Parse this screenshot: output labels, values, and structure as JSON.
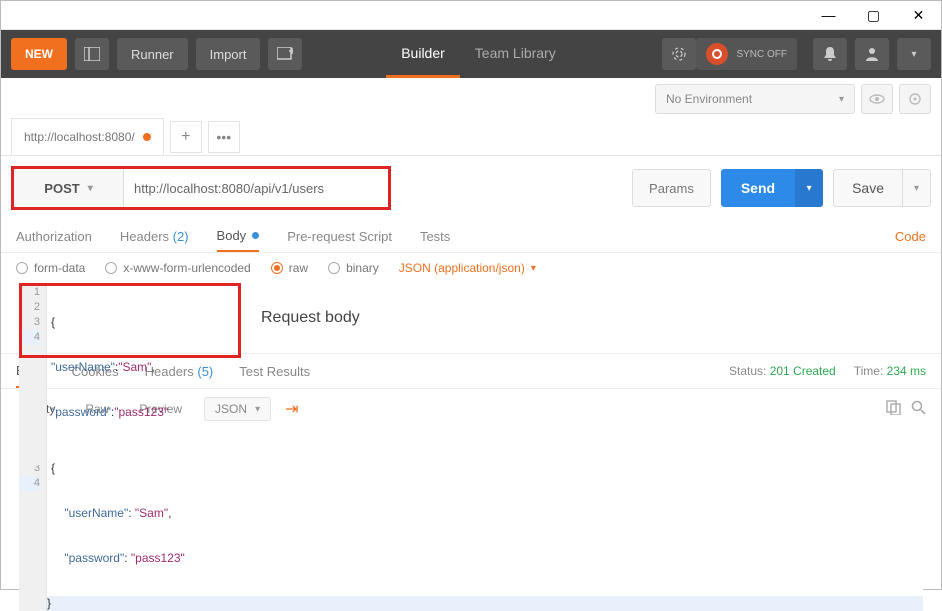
{
  "titlebar": {
    "min": "—",
    "max": "▢",
    "close": "✕"
  },
  "topbar": {
    "new": "NEW",
    "runner": "Runner",
    "import": "Import",
    "builder": "Builder",
    "team_library": "Team Library",
    "sync": "SYNC OFF"
  },
  "environment": {
    "none": "No Environment"
  },
  "tabs": {
    "current": "http://localhost:8080/"
  },
  "request": {
    "method": "POST",
    "url": "http://localhost:8080/api/v1/users",
    "params": "Params",
    "send": "Send",
    "save": "Save"
  },
  "req_tabs": {
    "authorization": "Authorization",
    "headers": "Headers",
    "headers_count": "(2)",
    "body": "Body",
    "prereq": "Pre-request Script",
    "tests": "Tests",
    "code": "Code"
  },
  "body_type": {
    "form_data": "form-data",
    "urlencoded": "x-www-form-urlencoded",
    "raw": "raw",
    "binary": "binary",
    "content_type": "JSON (application/json)"
  },
  "editor": {
    "lines": [
      "1",
      "2",
      "3",
      "4"
    ],
    "body_lines": [
      {
        "raw": "{"
      },
      {
        "key": "\"userName\"",
        "sep": ":",
        "val": "\"Sam\"",
        "tail": ","
      },
      {
        "key": "\"password\"",
        "sep": ":",
        "val": "\"pass123\"",
        "tail": ""
      },
      {
        "raw": "}"
      }
    ],
    "label": "Request body"
  },
  "response_tabs": {
    "body": "Body",
    "cookies": "Cookies",
    "headers": "Headers",
    "headers_count": "(5)",
    "tests": "Test Results",
    "status_label": "Status:",
    "status_value": "201 Created",
    "time_label": "Time:",
    "time_value": "234 ms"
  },
  "resp_toolbar": {
    "pretty": "Pretty",
    "raw": "Raw",
    "preview": "Preview",
    "format": "JSON"
  },
  "resp_editor": {
    "lines": [
      "1",
      "2",
      "3",
      "4"
    ],
    "body_lines": [
      {
        "raw": "{"
      },
      {
        "indent": "    ",
        "key": "\"userName\"",
        "sep": ": ",
        "val": "\"Sam\"",
        "tail": ","
      },
      {
        "indent": "    ",
        "key": "\"password\"",
        "sep": ": ",
        "val": "\"pass123\"",
        "tail": ""
      },
      {
        "raw": "}"
      }
    ]
  }
}
